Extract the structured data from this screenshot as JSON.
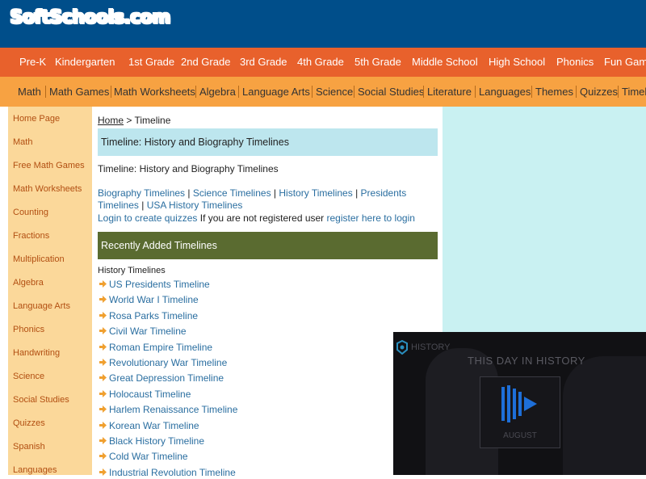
{
  "logo": {
    "text": "SoftSchools.com"
  },
  "nav_primary": [
    {
      "label": "Pre-K"
    },
    {
      "label": "Kindergarten"
    },
    {
      "label": "1st Grade"
    },
    {
      "label": "2nd Grade"
    },
    {
      "label": "3rd Grade"
    },
    {
      "label": "4th Grade"
    },
    {
      "label": "5th Grade"
    },
    {
      "label": "Middle School"
    },
    {
      "label": "High School"
    },
    {
      "label": "Phonics"
    },
    {
      "label": "Fun Gam"
    }
  ],
  "nav_secondary": [
    {
      "label": "Math"
    },
    {
      "label": "Math Games"
    },
    {
      "label": "Math Worksheets"
    },
    {
      "label": "Algebra"
    },
    {
      "label": "Language Arts"
    },
    {
      "label": "Science"
    },
    {
      "label": "Social Studies"
    },
    {
      "label": "Literature"
    },
    {
      "label": "Languages"
    },
    {
      "label": "Themes"
    },
    {
      "label": "Quizzes"
    },
    {
      "label": "Timel"
    }
  ],
  "sidebar": [
    {
      "label": "Home Page"
    },
    {
      "label": "Math"
    },
    {
      "label": "Free Math Games"
    },
    {
      "label": "Math Worksheets"
    },
    {
      "label": "Counting"
    },
    {
      "label": "Fractions"
    },
    {
      "label": "Multiplication"
    },
    {
      "label": "Algebra"
    },
    {
      "label": "Language Arts"
    },
    {
      "label": "Phonics"
    },
    {
      "label": "Handwriting"
    },
    {
      "label": "Science"
    },
    {
      "label": "Social Studies"
    },
    {
      "label": "Quizzes"
    },
    {
      "label": "Spanish"
    },
    {
      "label": "Languages"
    }
  ],
  "breadcrumb": {
    "home": "Home",
    "separator": " > ",
    "current": "Timeline"
  },
  "header_bar": {
    "title": "Timeline: History and Biography Timelines"
  },
  "subheading": "Timeline: History and Biography Timelines",
  "category_links": {
    "biography": "Biography Timelines",
    "sep": " | ",
    "science": "Science Timelines",
    "history": "History Timelines",
    "presidents_part1": "Presidents",
    "presidents_part2": "Timelines",
    "usa": "USA History Timelines"
  },
  "login": {
    "login_link": "Login to create quizzes",
    "middle_text": " If you are not registered user ",
    "register_link": "register here to login"
  },
  "recent_bar": {
    "title": "Recently Added Timelines"
  },
  "history_label": "History Timelines",
  "timelines": [
    {
      "label": "US Presidents Timeline"
    },
    {
      "label": "World War I Timeline"
    },
    {
      "label": "Rosa Parks Timeline"
    },
    {
      "label": "Civil War Timeline"
    },
    {
      "label": "Roman Empire Timeline"
    },
    {
      "label": "Revolutionary War Timeline"
    },
    {
      "label": "Great Depression Timeline"
    },
    {
      "label": "Holocaust Timeline"
    },
    {
      "label": "Harlem Renaissance Timeline"
    },
    {
      "label": "Korean War Timeline"
    },
    {
      "label": "Black History Timeline"
    },
    {
      "label": "Cold War Timeline"
    },
    {
      "label": "Industrial Revolution Timeline"
    }
  ],
  "video": {
    "brand": "HISTORY",
    "title": "THIS DAY IN HISTORY",
    "month": "AUGUST"
  },
  "colors": {
    "header": "#004e8a",
    "nav_primary": "#e8612c",
    "nav_secondary": "#f7a242",
    "sidebar": "#fbd89a",
    "header_bar": "#bde6ee",
    "recent_bar": "#5a6b30",
    "right_panel": "#c9f1f2",
    "link": "#2a6ea0",
    "arrow": "#f0a030"
  },
  "icons": {
    "list_bullet": "arrow-right-icon",
    "video_play": "play-icon",
    "video_brand": "history-logo-icon"
  }
}
